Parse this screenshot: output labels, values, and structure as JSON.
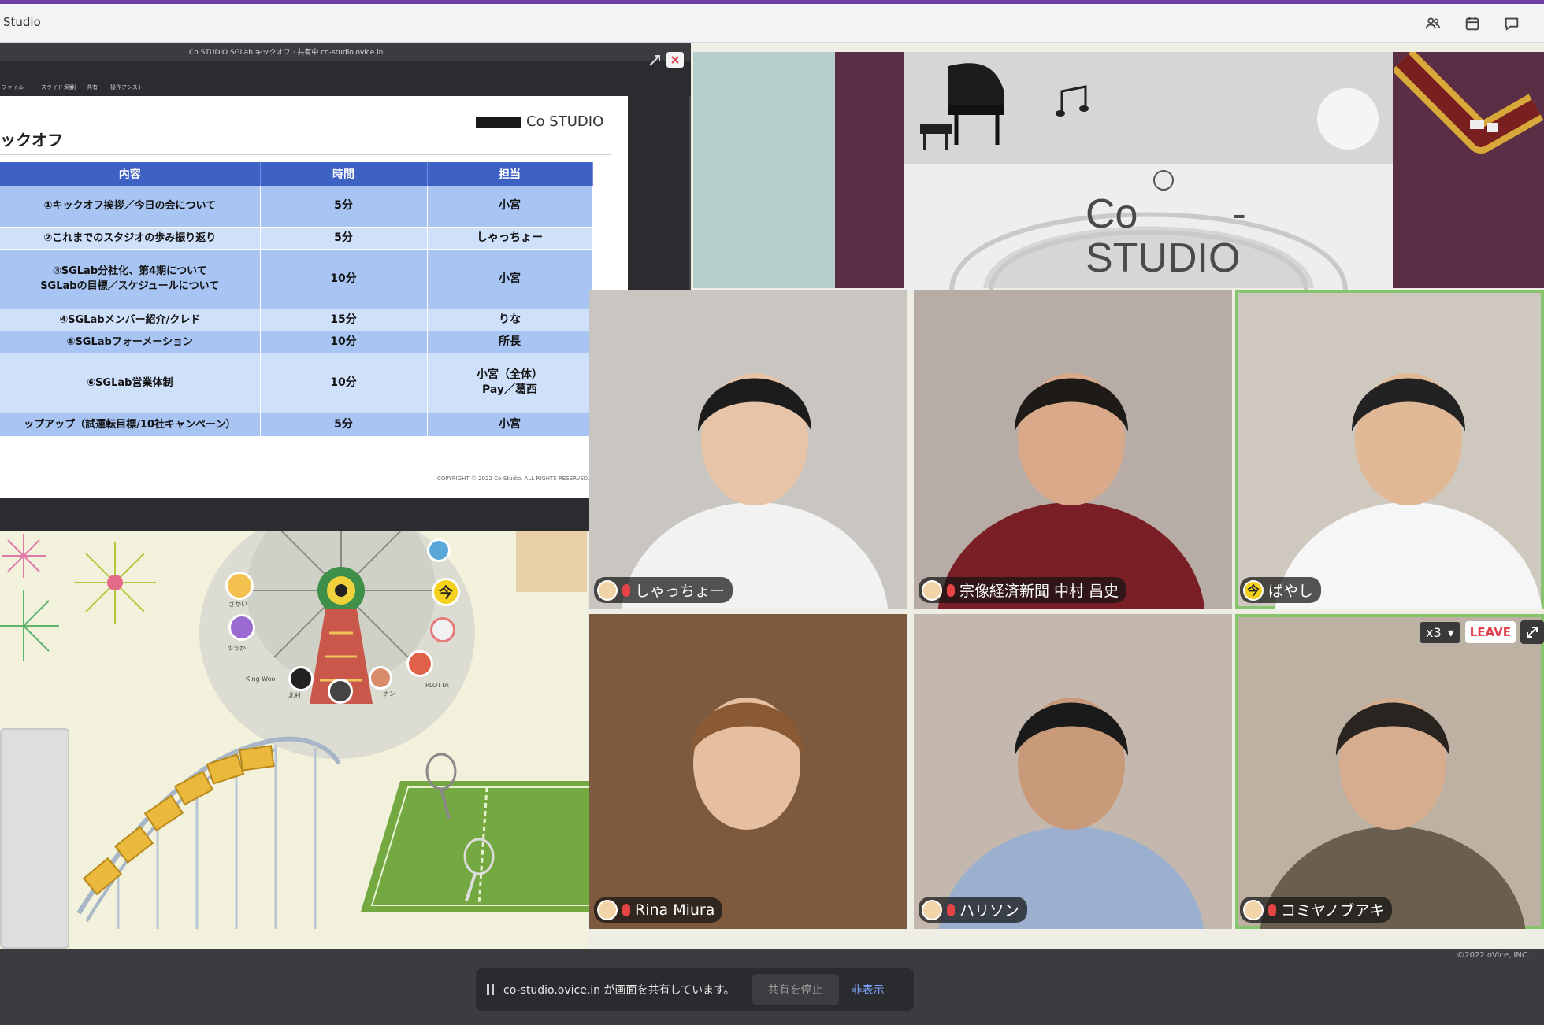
{
  "window": {
    "title": "Studio"
  },
  "share": {
    "top_title": "Co STUDIO SGLab キックオフ  · 共有中 co-studio.ovice.in",
    "toolbar": [
      "ファイル",
      "スライドショー",
      "印刷",
      "共有",
      "操作アシスト"
    ],
    "slide": {
      "title": "ックオフ",
      "logo_text": "Co STUDIO",
      "headers": [
        "内容",
        "時間",
        "担当"
      ],
      "rows": [
        {
          "item": "①キックオフ挨拶／今日の会について",
          "time": "5分",
          "owner": "小宮"
        },
        {
          "item": "②これまでのスタジオの歩み振り返り",
          "time": "5分",
          "owner": "しゃっちょー"
        },
        {
          "item": "③SGLab分社化、第4期について\nSGLabの目標／スケジュールについて",
          "time": "10分",
          "owner": "小宮"
        },
        {
          "item": "④SGLabメンバー紹介/クレド",
          "time": "15分",
          "owner": "りな"
        },
        {
          "item": "⑤SGLabフォーメーション",
          "time": "10分",
          "owner": "所長"
        },
        {
          "item": "⑥SGLab営業体制",
          "time": "10分",
          "owner": "小宮（全体）\nPay／葛西"
        },
        {
          "item": "ップアップ（試運転目標/10社キャンペーン）",
          "time": "5分",
          "owner": "小宮"
        }
      ],
      "copyright": "COPYRIGHT © 2022 Co-Studio. ALL RIGHTS RESERVED."
    }
  },
  "room": {
    "logo_line1": "Co",
    "logo_line2": "STUDIO",
    "logo_dash": "-"
  },
  "map": {
    "avatar_labels": [
      "King Woo",
      "北村",
      "ナン",
      "PLOTTA",
      "さかい",
      "ゆうか"
    ],
    "badge_char": "今"
  },
  "video": {
    "tiles": [
      {
        "name": "しゃっちょー",
        "bg": "#c9c6c2"
      },
      {
        "name": "宗像経済新聞 中村 昌史",
        "bg": "#b8ada6"
      },
      {
        "name": "ばやし",
        "badge": "今",
        "bg": "#cfc8bf"
      },
      {
        "name": "Rina Miura",
        "bg": "#7d5a3e"
      },
      {
        "name": "ハリソン",
        "bg": "#c4b8ae"
      },
      {
        "name": "コミヤノブアキ",
        "bg": "#bdb1a3"
      }
    ],
    "speed_label": "x3",
    "leave_label": "LEAVE"
  },
  "footer": {
    "corner_copy": "©2022 oVice, INC.",
    "notice_text": "co-studio.ovice.in が画面を共有しています。",
    "stop_label": "共有を停止",
    "hide_label": "非表示"
  },
  "colors": {
    "accent": "#6d3fa6",
    "active_outline": "#86c46e",
    "table_header": "#3d62c4",
    "leave": "#e2404c"
  }
}
